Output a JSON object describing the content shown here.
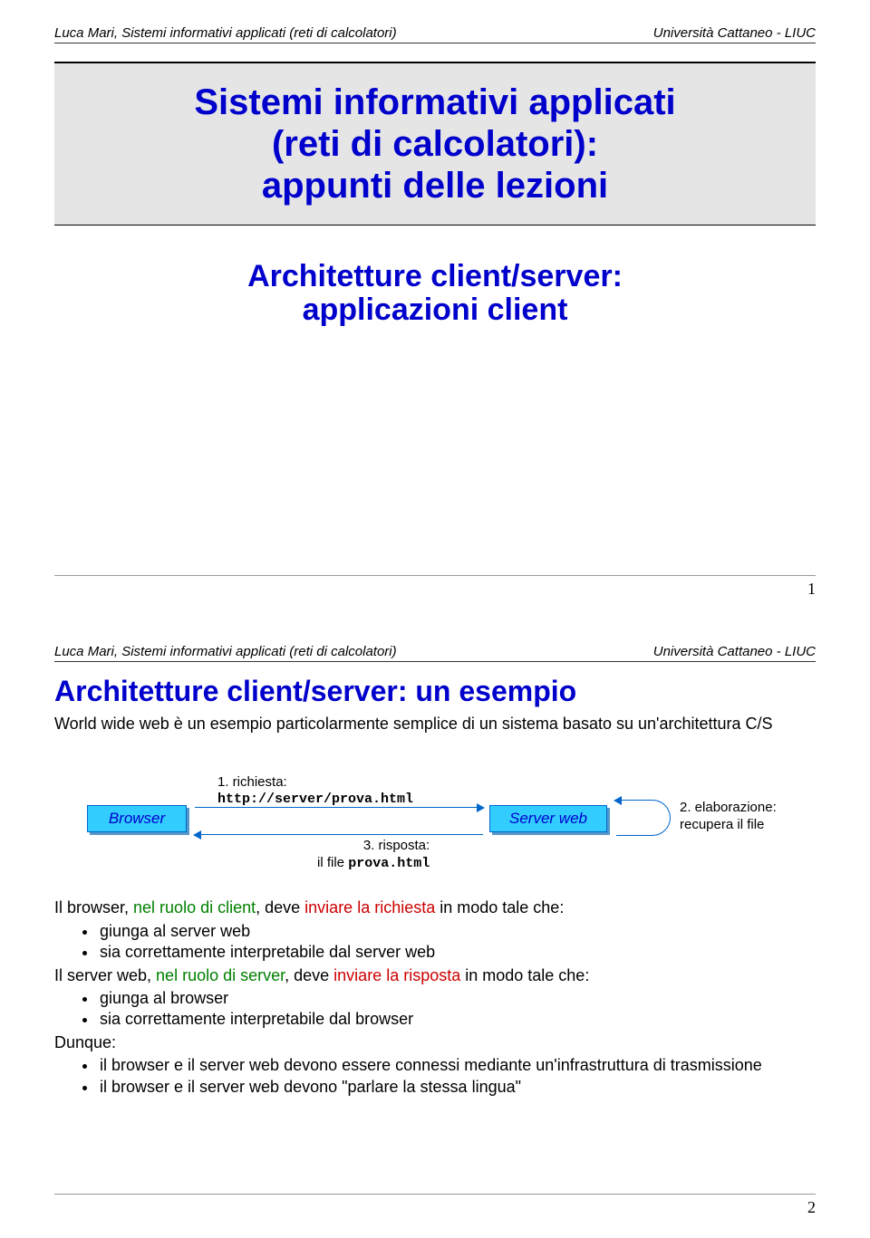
{
  "header": {
    "left": "Luca Mari, Sistemi informativi applicati (reti di calcolatori)",
    "right": "Università Cattaneo - LIUC"
  },
  "slide1": {
    "title_line1": "Sistemi informativi applicati",
    "title_line2": "(reti di calcolatori):",
    "title_line3": "appunti delle lezioni",
    "subtitle_line1": "Architetture client/server:",
    "subtitle_line2": "applicazioni client",
    "page": "1"
  },
  "slide2": {
    "heading": "Architetture client/server: un esempio",
    "intro": "World wide web è un esempio particolarmente semplice di un sistema basato su un'architettura C/S",
    "diagram": {
      "browser": "Browser",
      "server": "Server web",
      "req_label": "1. richiesta:",
      "req_url": "http://server/prova.html",
      "res_label": "3. risposta:",
      "res_file_prefix": "il file ",
      "res_file": "prova.html",
      "elab_line1": "2. elaborazione:",
      "elab_line2": "recupera il file"
    },
    "body": {
      "l1a": "Il browser, ",
      "l1b": "nel ruolo di client",
      "l1c": ", deve ",
      "l1d": "inviare la richiesta",
      "l1e": " in modo tale che:",
      "b1": "giunga al server web",
      "b2": "sia correttamente interpretabile dal server web",
      "l2a": "Il server web, ",
      "l2b": "nel ruolo di server",
      "l2c": ", deve ",
      "l2d": "inviare la risposta",
      "l2e": " in modo tale che:",
      "b3": "giunga al browser",
      "b4": "sia correttamente interpretabile dal browser",
      "dunque": "Dunque:",
      "b5": "il browser e il server web devono essere connessi mediante un'infrastruttura di trasmissione",
      "b6": "il browser e il server web devono \"parlare la stessa lingua\""
    },
    "page": "2"
  }
}
